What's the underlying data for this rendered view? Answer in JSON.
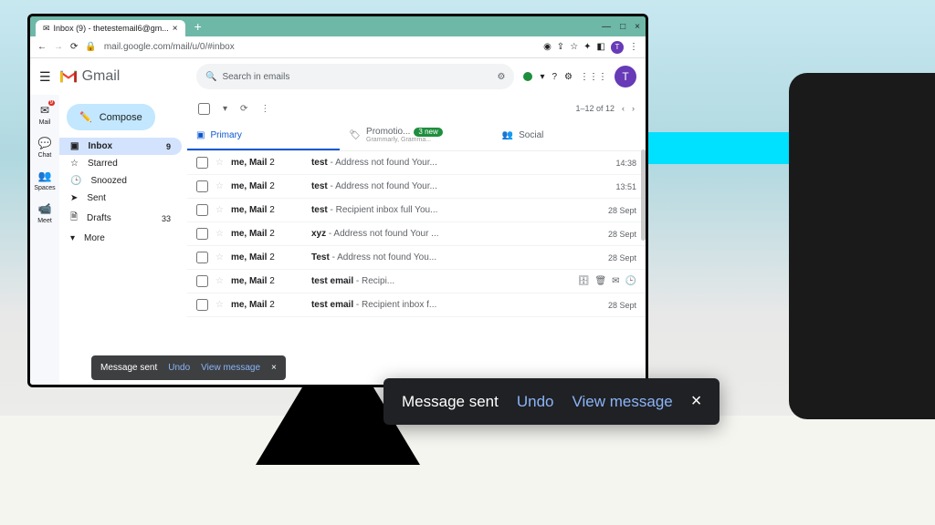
{
  "browser": {
    "tab_title": "Inbox (9) - thetestemail6@gm...",
    "url": "mail.google.com/mail/u/0/#inbox"
  },
  "header": {
    "product": "Gmail",
    "search_placeholder": "Search in emails",
    "avatar_letter": "T"
  },
  "leftrail": [
    {
      "label": "Mail",
      "badge": "9"
    },
    {
      "label": "Chat"
    },
    {
      "label": "Spaces"
    },
    {
      "label": "Meet"
    }
  ],
  "sidebar": {
    "compose_label": "Compose",
    "items": [
      {
        "icon": "inbox",
        "label": "Inbox",
        "count": "9",
        "active": true
      },
      {
        "icon": "star",
        "label": "Starred"
      },
      {
        "icon": "clock",
        "label": "Snoozed"
      },
      {
        "icon": "send",
        "label": "Sent"
      },
      {
        "icon": "file",
        "label": "Drafts",
        "count": "33"
      },
      {
        "icon": "more",
        "label": "More"
      }
    ]
  },
  "toolbar": {
    "page_info": "1–12 of 12"
  },
  "category_tabs": {
    "primary": "Primary",
    "promotions": "Promotio...",
    "promo_badge": "3 new",
    "promo_sub": "Grammarly, Gramma...",
    "social": "Social"
  },
  "emails": [
    {
      "sender": "me, Mail",
      "n": "2",
      "subject": "test",
      "snippet": "Address not found Your...",
      "date": "14:38"
    },
    {
      "sender": "me, Mail",
      "n": "2",
      "subject": "test",
      "snippet": "Address not found Your...",
      "date": "13:51"
    },
    {
      "sender": "me, Mail",
      "n": "2",
      "subject": "test",
      "snippet": "Recipient inbox full You...",
      "date": "28 Sept"
    },
    {
      "sender": "me, Mail",
      "n": "2",
      "subject": "xyz",
      "snippet": "Address not found Your ...",
      "date": "28 Sept"
    },
    {
      "sender": "me, Mail",
      "n": "2",
      "subject": "Test",
      "snippet": "Address not found You...",
      "date": "28 Sept"
    },
    {
      "sender": "me, Mail",
      "n": "2",
      "subject": "test email",
      "snippet": "Recipi...",
      "date": "",
      "hover": true
    },
    {
      "sender": "me, Mail",
      "n": "2",
      "subject": "test email",
      "snippet": "Recipient inbox f...",
      "date": "28 Sept"
    }
  ],
  "toast": {
    "message": "Message sent",
    "undo": "Undo",
    "view": "View message"
  }
}
